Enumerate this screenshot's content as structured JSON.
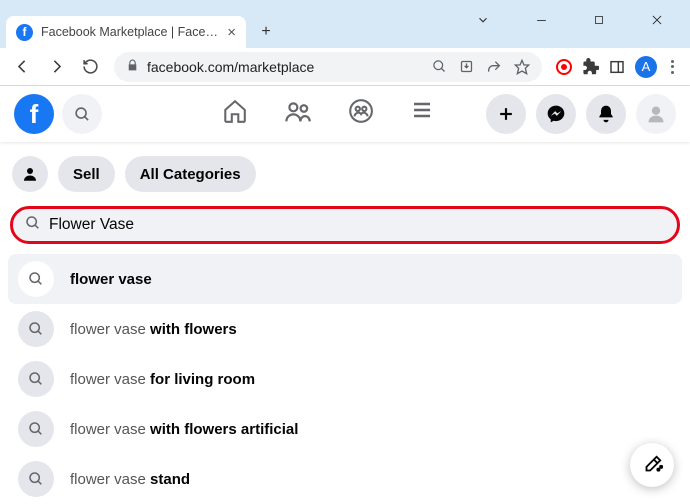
{
  "browser": {
    "tab_title": "Facebook Marketplace | Facebook",
    "url": "facebook.com/marketplace",
    "profile_initial": "A"
  },
  "mp_bar": {
    "sell": "Sell",
    "categories": "All Categories"
  },
  "search": {
    "value": "Flower Vase"
  },
  "suggestions": [
    {
      "prefix": "",
      "bold": "flower vase",
      "highlighted": true
    },
    {
      "prefix": "flower vase ",
      "bold": "with flowers",
      "highlighted": false
    },
    {
      "prefix": "flower vase ",
      "bold": "for living room",
      "highlighted": false
    },
    {
      "prefix": "flower vase ",
      "bold": "with flowers artificial",
      "highlighted": false
    },
    {
      "prefix": "flower vase ",
      "bold": "stand",
      "highlighted": false
    }
  ]
}
